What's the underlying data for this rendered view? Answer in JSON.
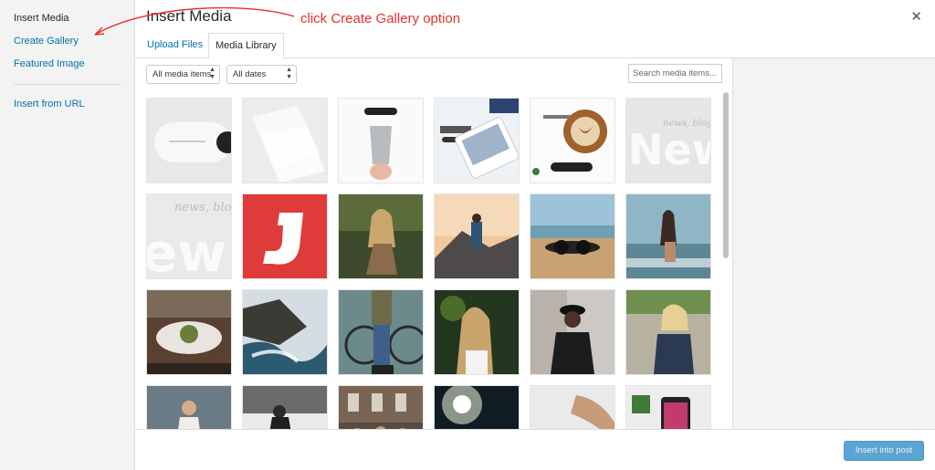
{
  "frame": {
    "title": "Insert Media",
    "close_glyph": "✕"
  },
  "menu": {
    "items": [
      {
        "label": "Insert Media",
        "active": true
      },
      {
        "label": "Create Gallery",
        "active": false
      },
      {
        "label": "Featured Image",
        "active": false
      },
      {
        "label": "Insert from URL",
        "active": false
      }
    ]
  },
  "tabs": [
    {
      "label": "Upload Files",
      "active": false
    },
    {
      "label": "Media Library",
      "active": true
    }
  ],
  "filters": {
    "type_selected": "All media items",
    "date_selected": "All dates",
    "search_placeholder": "Search media items..."
  },
  "footer": {
    "insert_button": "Insert into post"
  },
  "annotation": {
    "text": "click Create Gallery option",
    "color": "#e8312a"
  },
  "colors": {
    "accent_link": "#0073aa",
    "primary_button": "#5ca5d3"
  },
  "media": [
    {
      "name": "white-controller"
    },
    {
      "name": "white-cards"
    },
    {
      "name": "metal-cup-ad"
    },
    {
      "name": "tablet-ad"
    },
    {
      "name": "latte-ad"
    },
    {
      "name": "news-blog-grey"
    },
    {
      "name": "news-blog-white"
    },
    {
      "name": "red-j-logo"
    },
    {
      "name": "woman-forest"
    },
    {
      "name": "man-mountain"
    },
    {
      "name": "sunglasses-sand"
    },
    {
      "name": "woman-beach"
    },
    {
      "name": "restaurant-dish"
    },
    {
      "name": "rocky-coast"
    },
    {
      "name": "bicycle-legs"
    },
    {
      "name": "woman-portrait"
    },
    {
      "name": "man-hat"
    },
    {
      "name": "woman-street"
    },
    {
      "name": "woman-dress"
    },
    {
      "name": "person-snow"
    },
    {
      "name": "group-building"
    },
    {
      "name": "concert-lights"
    },
    {
      "name": "watch-hands"
    },
    {
      "name": "phone-hand"
    }
  ]
}
